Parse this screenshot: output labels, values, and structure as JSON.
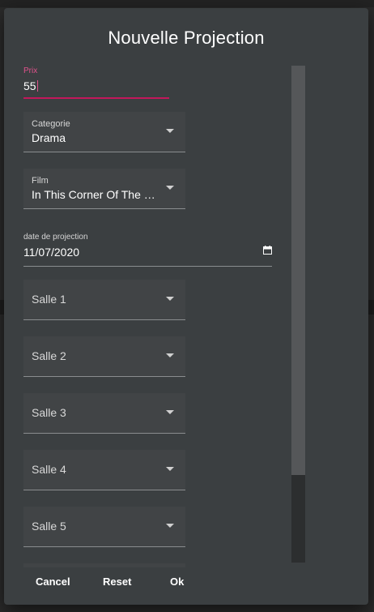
{
  "dialog": {
    "title": "Nouvelle Projection",
    "prix": {
      "label": "Prix",
      "value": "55"
    },
    "categorie": {
      "label": "Categorie",
      "value": "Drama"
    },
    "film": {
      "label": "Film",
      "value": "In This Corner Of The W..."
    },
    "date": {
      "label": "date de projection",
      "value": "11/07/2020"
    },
    "salles": [
      {
        "placeholder": "Salle 1"
      },
      {
        "placeholder": "Salle 2"
      },
      {
        "placeholder": "Salle 3"
      },
      {
        "placeholder": "Salle 4"
      },
      {
        "placeholder": "Salle 5"
      }
    ],
    "actions": {
      "cancel": "Cancel",
      "reset": "Reset",
      "ok": "Ok"
    }
  },
  "colors": {
    "accent": "#e0528c",
    "dialog_bg": "#3b3f41",
    "select_bg": "#414446"
  },
  "icons": {
    "dropdown": "chevron-down-icon",
    "date": "calendar-icon"
  }
}
